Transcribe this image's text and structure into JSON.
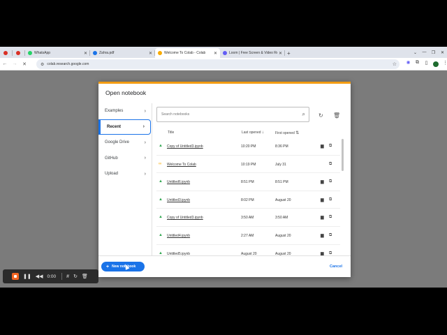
{
  "browser": {
    "tabs": [
      {
        "label": "",
        "icon": "record-icon",
        "color": "#d93025",
        "pinned": true
      },
      {
        "label": "",
        "icon": "record-icon",
        "color": "#d93025",
        "pinned": true
      },
      {
        "label": "WhatsApp",
        "icon": "whatsapp-icon",
        "color": "#25d366",
        "active": false
      },
      {
        "label": "Zahra.pdf",
        "icon": "drive-icon",
        "color": "#1a73e8",
        "active": false
      },
      {
        "label": "Welcome To Colab - Colab",
        "icon": "colab-icon",
        "color": "#f9ab00",
        "active": true
      },
      {
        "label": "Loom | Free Screen & Video Re",
        "icon": "loom-icon",
        "color": "#625df5",
        "active": false
      }
    ],
    "url": "colab.research.google.com"
  },
  "dialog": {
    "title": "Open notebook",
    "nav": [
      {
        "label": "Examples",
        "active": false
      },
      {
        "label": "Recent",
        "active": true
      },
      {
        "label": "Google Drive",
        "active": false
      },
      {
        "label": "GitHub",
        "active": false
      },
      {
        "label": "Upload",
        "active": false
      }
    ],
    "search_placeholder": "Search notebooks",
    "columns": {
      "title": "Title",
      "last_opened": "Last opened",
      "first_opened": "First opened"
    },
    "rows": [
      {
        "name": "Copy of Untitled3.ipynb",
        "last": "10:20 PM",
        "first": "8:36 PM",
        "type": "drive",
        "folder": true
      },
      {
        "name": "Welcome To Colab",
        "last": "10:19 PM",
        "first": "July 31",
        "type": "colab",
        "folder": false
      },
      {
        "name": "Untitled6.ipynb",
        "last": "8:51 PM",
        "first": "8:51 PM",
        "type": "drive",
        "folder": true
      },
      {
        "name": "Untitled3.ipynb",
        "last": "8:02 PM",
        "first": "August 20",
        "type": "drive",
        "folder": true
      },
      {
        "name": "Copy of Untitled3.ipynb",
        "last": "3:50 AM",
        "first": "3:50 AM",
        "type": "drive",
        "folder": true
      },
      {
        "name": "Untitled4.ipynb",
        "last": "2:27 AM",
        "first": "August 20",
        "type": "drive",
        "folder": true
      },
      {
        "name": "Untitled5.ipynb",
        "last": "August 20",
        "first": "August 20",
        "type": "drive",
        "folder": true
      }
    ],
    "new_notebook_label": "New notebook",
    "cancel_label": "Cancel"
  },
  "recorder": {
    "time": "0:00"
  },
  "colors": {
    "accent": "#1a73e8",
    "top_bar": "#f39c12",
    "recorder_stop": "#f26522"
  }
}
